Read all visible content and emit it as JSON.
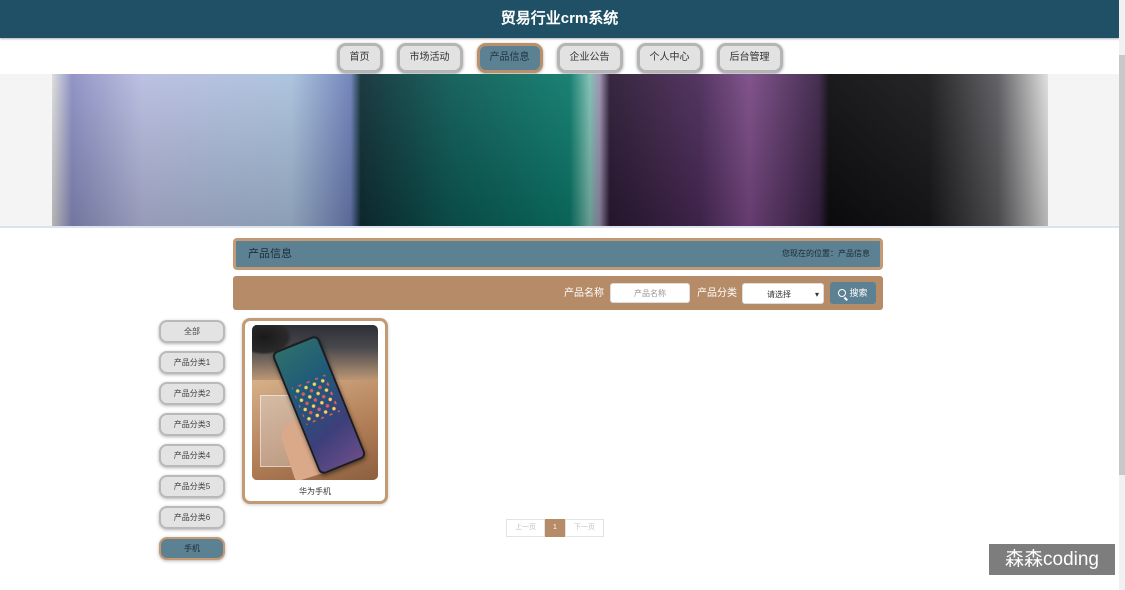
{
  "site": {
    "title": "贸易行业crm系统"
  },
  "nav": {
    "items": [
      {
        "label": "首页"
      },
      {
        "label": "市场活动"
      },
      {
        "label": "产品信息"
      },
      {
        "label": "企业公告"
      },
      {
        "label": "个人中心"
      },
      {
        "label": "后台管理"
      }
    ],
    "active": "产品信息"
  },
  "position_bar": {
    "title": "产品信息",
    "crumb": "您现在的位置：产品信息"
  },
  "search": {
    "name_label": "产品名称",
    "name_placeholder": "产品名称",
    "category_label": "产品分类",
    "category_selected": "请选择",
    "button_label": "搜索"
  },
  "categories": {
    "items": [
      {
        "label": "全部"
      },
      {
        "label": "产品分类1"
      },
      {
        "label": "产品分类2"
      },
      {
        "label": "产品分类3"
      },
      {
        "label": "产品分类4"
      },
      {
        "label": "产品分类5"
      },
      {
        "label": "产品分类6"
      },
      {
        "label": "手机"
      }
    ],
    "active": "手机"
  },
  "products": [
    {
      "name": "华为手机"
    }
  ],
  "pagination": {
    "prev_label": "上一页",
    "current_page": "1",
    "next_label": "下一页"
  },
  "watermark": {
    "text": "森森coding"
  },
  "colors": {
    "header_bg": "#1f5066",
    "accent_blue": "#5b8193",
    "accent_tan": "#b68b67",
    "border_tan": "#c49a74"
  }
}
